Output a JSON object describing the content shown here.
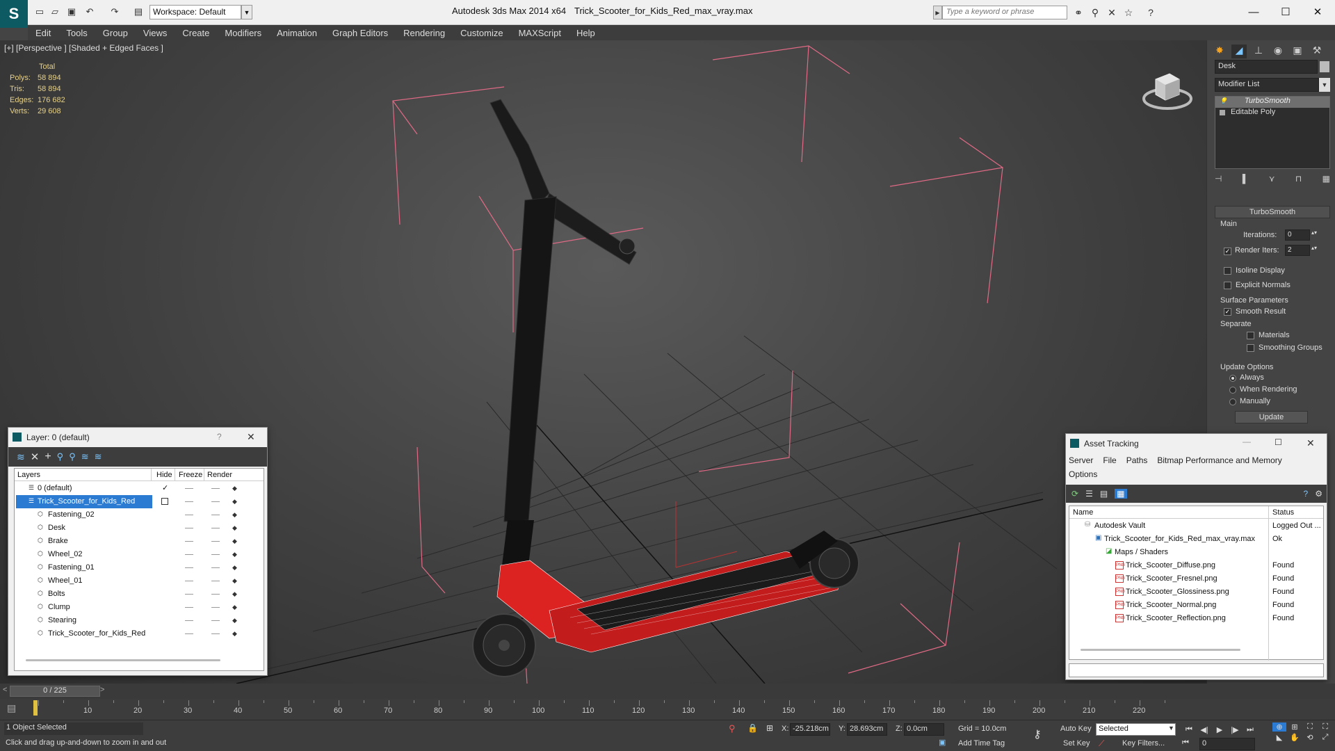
{
  "window": {
    "app_title": "Autodesk 3ds Max  2014 x64",
    "file_title": "Trick_Scooter_for_Kids_Red_max_vray.max",
    "workspace": "Workspace: Default",
    "search_placeholder": "Type a keyword or phrase"
  },
  "menu": [
    "Edit",
    "Tools",
    "Group",
    "Views",
    "Create",
    "Modifiers",
    "Animation",
    "Graph Editors",
    "Rendering",
    "Customize",
    "MAXScript",
    "Help"
  ],
  "viewport": {
    "label": "[+] [Perspective ] [Shaded + Edged Faces ]",
    "stats_header": "Total",
    "stats": [
      {
        "k": "Polys:",
        "v": "58 894"
      },
      {
        "k": "Tris:",
        "v": "58 894"
      },
      {
        "k": "Edges:",
        "v": "176 682"
      },
      {
        "k": "Verts:",
        "v": "29 608"
      }
    ]
  },
  "command_panel": {
    "object_name": "Desk",
    "modifier_list": "Modifier List",
    "stack": [
      "TurboSmooth",
      "Editable Poly"
    ],
    "rollout_title": "TurboSmooth",
    "main_label": "Main",
    "iterations_label": "Iterations:",
    "iterations_value": "0",
    "render_iters_label": "Render Iters:",
    "render_iters_value": "2",
    "isoline": "Isoline Display",
    "explicit_normals": "Explicit Normals",
    "surface_params": "Surface Parameters",
    "smooth_result": "Smooth Result",
    "separate": "Separate",
    "materials": "Materials",
    "smoothing_groups": "Smoothing Groups",
    "update_options": "Update Options",
    "always": "Always",
    "when_rendering": "When Rendering",
    "manually": "Manually",
    "update_button": "Update"
  },
  "layer_dialog": {
    "title": "Layer: 0 (default)",
    "help": "?",
    "col_layers": "Layers",
    "col_hide": "Hide",
    "col_freeze": "Freeze",
    "col_render": "Render",
    "rows": [
      {
        "name": "0 (default)"
      },
      {
        "name": "Trick_Scooter_for_Kids_Red"
      },
      {
        "name": "Fastening_02"
      },
      {
        "name": "Desk"
      },
      {
        "name": "Brake"
      },
      {
        "name": "Wheel_02"
      },
      {
        "name": "Fastening_01"
      },
      {
        "name": "Wheel_01"
      },
      {
        "name": "Bolts"
      },
      {
        "name": "Clump"
      },
      {
        "name": "Stearing"
      },
      {
        "name": "Trick_Scooter_for_Kids_Red"
      }
    ]
  },
  "asset_dialog": {
    "title": "Asset Tracking",
    "menu": [
      "Server",
      "File",
      "Paths",
      "Bitmap Performance and Memory"
    ],
    "menu2": "Options",
    "col_name": "Name",
    "col_status": "Status",
    "rows": [
      {
        "name": "Autodesk Vault",
        "status": "Logged Out ..."
      },
      {
        "name": "Trick_Scooter_for_Kids_Red_max_vray.max",
        "status": "Ok"
      },
      {
        "name": "Maps / Shaders",
        "status": ""
      },
      {
        "name": "Trick_Scooter_Diffuse.png",
        "status": "Found"
      },
      {
        "name": "Trick_Scooter_Fresnel.png",
        "status": "Found"
      },
      {
        "name": "Trick_Scooter_Glossiness.png",
        "status": "Found"
      },
      {
        "name": "Trick_Scooter_Normal.png",
        "status": "Found"
      },
      {
        "name": "Trick_Scooter_Reflection.png",
        "status": "Found"
      }
    ]
  },
  "timeline": {
    "frame": "0 / 225",
    "ticks": [
      "10",
      "20",
      "30",
      "40",
      "50",
      "60",
      "70",
      "80",
      "90",
      "100",
      "110",
      "120",
      "130",
      "140",
      "150",
      "160",
      "170",
      "180",
      "190",
      "200",
      "210",
      "220"
    ]
  },
  "status": {
    "selected": "1 Object Selected",
    "prompt": "Click and drag up-and-down to zoom in and out",
    "x_label": "X:",
    "x_value": "-25.218cm",
    "y_label": "Y:",
    "y_value": "28.693cm",
    "z_label": "Z:",
    "z_value": "0.0cm",
    "grid": "Grid = 10.0cm",
    "add_time_tag": "Add Time Tag",
    "auto_key": "Auto Key",
    "set_key": "Set Key",
    "selected_mode": "Selected",
    "key_filters": "Key Filters...",
    "frame_value": "0"
  }
}
